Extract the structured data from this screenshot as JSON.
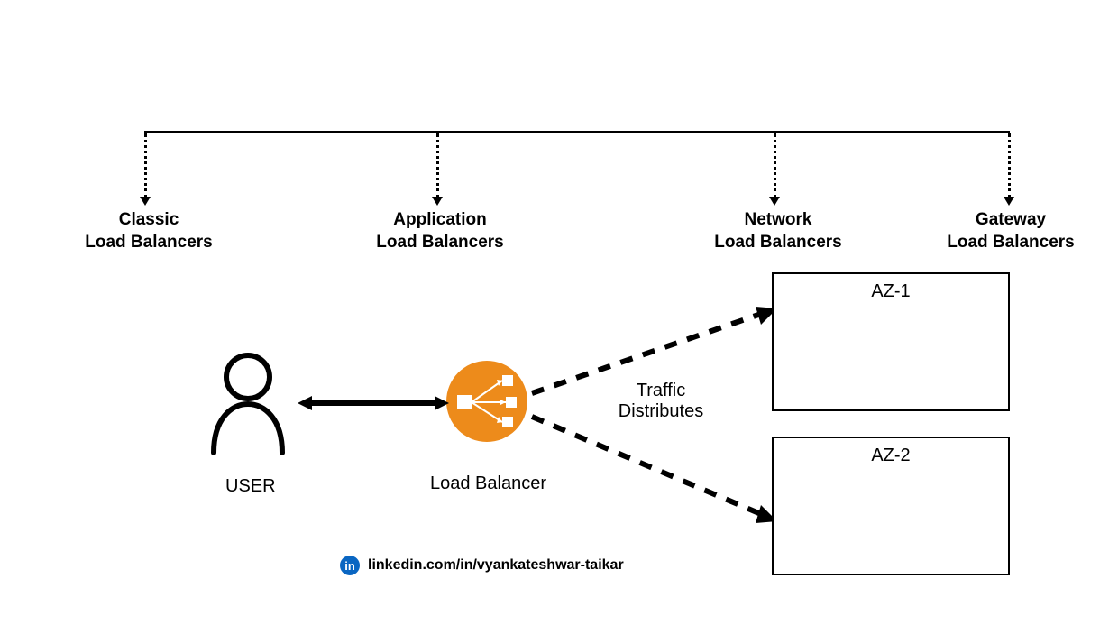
{
  "types": {
    "classic": {
      "line1": "Classic",
      "line2": "Load Balancers"
    },
    "application": {
      "line1": "Application",
      "line2": "Load Balancers"
    },
    "network": {
      "line1": "Network",
      "line2": "Load Balancers"
    },
    "gateway": {
      "line1": "Gateway",
      "line2": "Load Balancers"
    }
  },
  "labels": {
    "user": "USER",
    "loadBalancer": "Load Balancer",
    "traffic1": "Traffic",
    "traffic2": "Distributes",
    "az1": "AZ-1",
    "az2": "AZ-2"
  },
  "attribution": {
    "url": "linkedin.com/in/vyankateshwar-taikar",
    "iconText": "in"
  },
  "colors": {
    "accent": "#ED8B1B",
    "linkedin": "#0A66C2"
  }
}
